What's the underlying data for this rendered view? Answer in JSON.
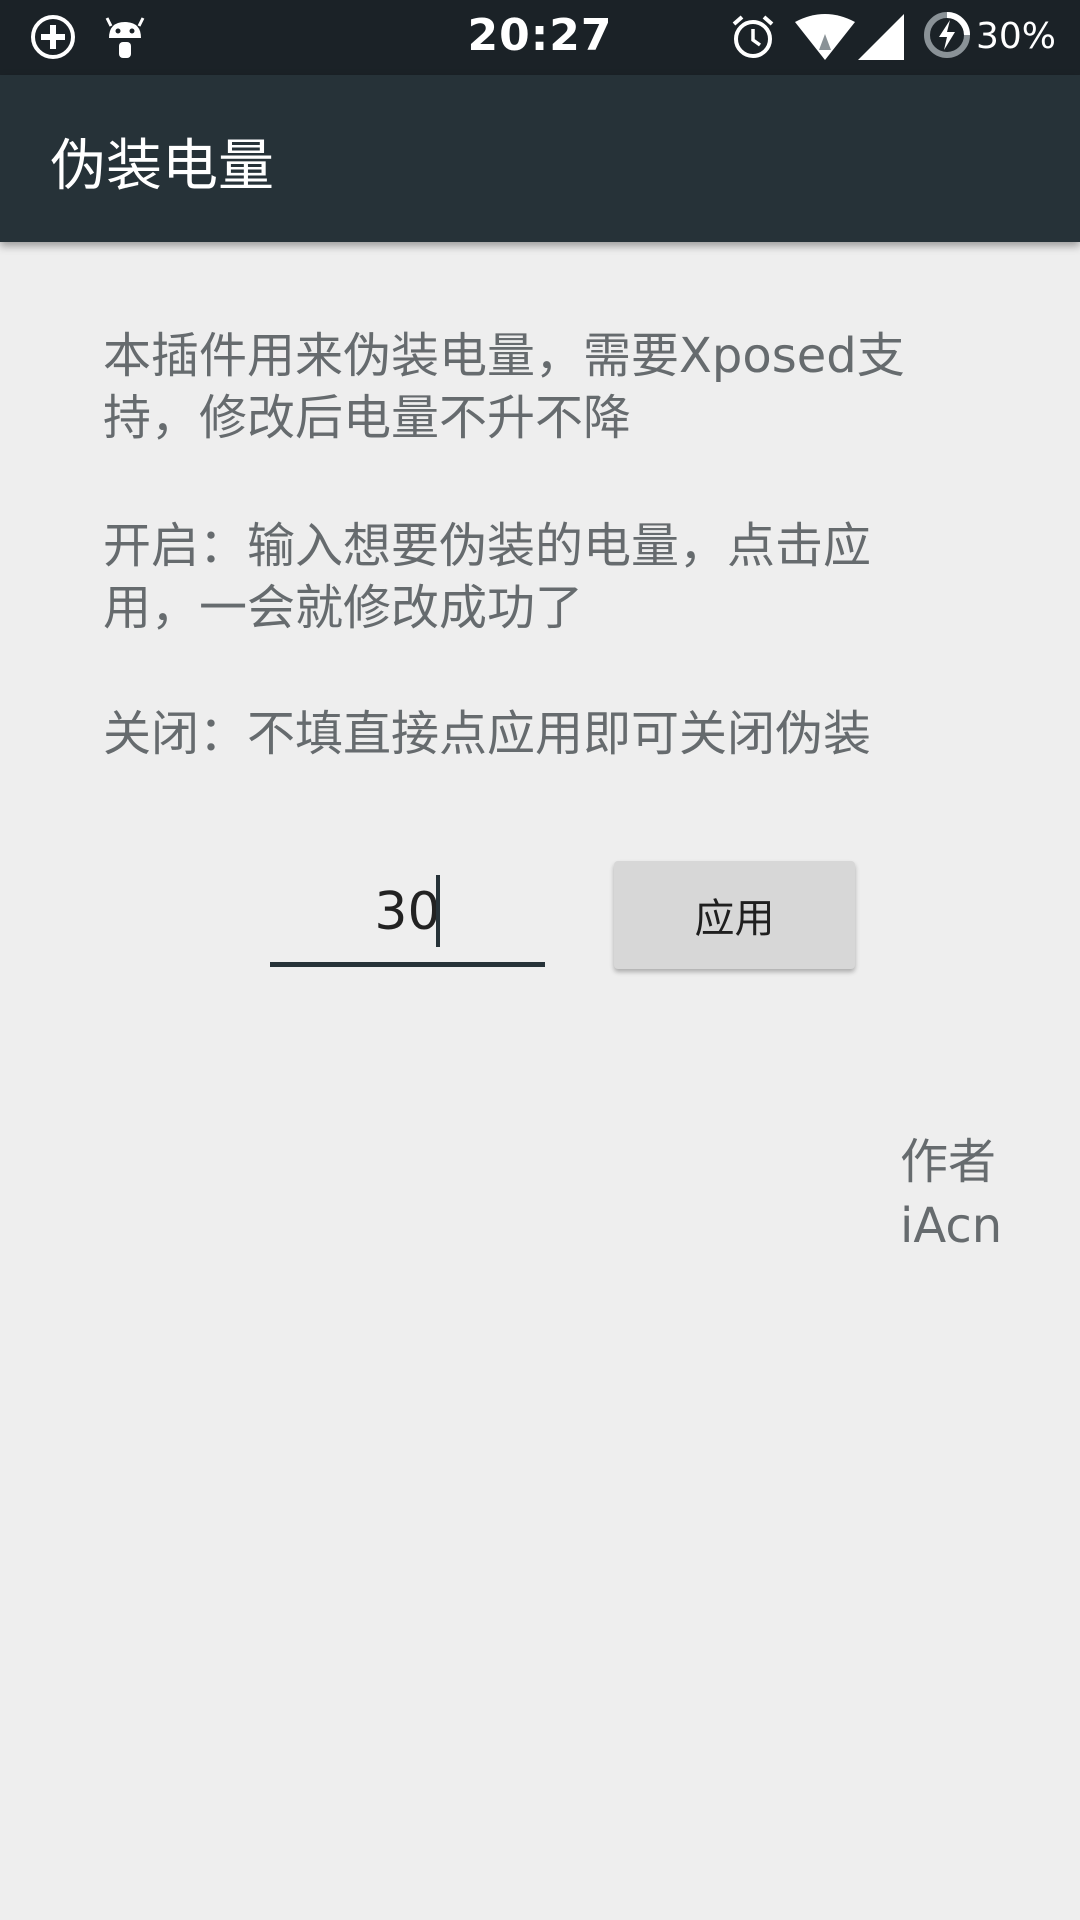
{
  "status_bar": {
    "time": "20:27",
    "battery_percent": "30%",
    "icons": [
      "data-saver-icon",
      "android-debug-icon",
      "alarm-icon",
      "wifi-icon",
      "cell-signal-icon",
      "battery-charging-icon"
    ]
  },
  "app_bar": {
    "title": "伪装电量"
  },
  "main": {
    "desc_line1": "本插件用来伪装电量，需要Xposed支",
    "desc_line2": "持，修改后电量不升不降",
    "open_line1": "开启：输入想要伪装的电量，点击应",
    "open_line2": "用，一会就修改成功了",
    "close_text": "关闭：不填直接点应用即可关闭伪装",
    "battery_input_value": "30",
    "apply_label": "应用",
    "author_label": "作者",
    "author_name": "iAcn"
  },
  "colors": {
    "status_bar": "#1b2227",
    "app_bar": "#263238",
    "background": "#eeeeee",
    "body_text": "#666b6e",
    "button": "#d7d7d7"
  }
}
